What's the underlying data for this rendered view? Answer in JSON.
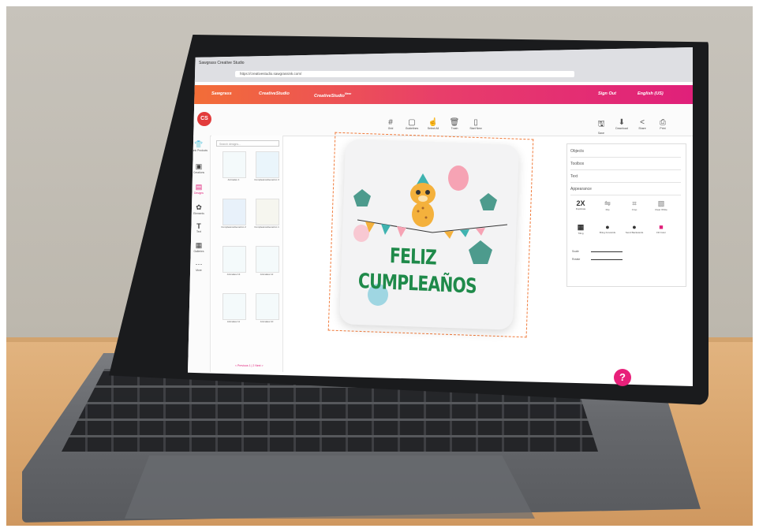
{
  "browser": {
    "tab_title": "Sawgrass Creative Studio",
    "url": "https://creativestudio.sawgrassink.com/"
  },
  "nav": {
    "brand": "Sawgrass",
    "creative_studio": "CreativeStudio",
    "creative_studio_new": "CreativeStudio",
    "new_badge": "New",
    "sign_out": "Sign Out",
    "language": "English (US)"
  },
  "logo": "CS",
  "toolbar": {
    "grid": "Grid",
    "guidelines": "Guidelines",
    "select_all": "Select All",
    "trash": "Trash",
    "start_new": "Start New",
    "save": "Save",
    "download": "Download",
    "share": "Share",
    "print": "Print"
  },
  "leftnav": {
    "items": [
      {
        "label": "Blank Products",
        "icon": "tshirt-icon",
        "glyph": "👕"
      },
      {
        "label": "Creations",
        "icon": "creations-icon",
        "glyph": "▣"
      },
      {
        "label": "Designs",
        "icon": "designs-icon",
        "glyph": "▤"
      },
      {
        "label": "Elements",
        "icon": "elements-icon",
        "glyph": "✿"
      },
      {
        "label": "Text",
        "icon": "text-icon",
        "glyph": "T"
      },
      {
        "label": "Galleries",
        "icon": "galleries-icon",
        "glyph": "▦"
      },
      {
        "label": "More",
        "icon": "more-icon",
        "glyph": "⋯"
      }
    ]
  },
  "designs_panel": {
    "search_placeholder": "Search designs...",
    "thumbs": [
      "Animales 1",
      "CumpleanosGenerico 3",
      "CumpleanosGenerico 2",
      "CumpleanosGenerico 1",
      "Animales 13",
      "Animales 12",
      "Animales 11",
      "Animales 10"
    ],
    "pager": "< Previous 1 | 2 Next >"
  },
  "canvas": {
    "line1": "FELIZ",
    "line2": "CUMPLEAÑOS"
  },
  "right_panel": {
    "objects": "Objects",
    "toolbox": "Toolbox",
    "text": "Text",
    "appearance": "Appearance",
    "tools": [
      {
        "label": "Duplicate",
        "glyph": "2X"
      },
      {
        "label": "Flip",
        "glyph": "⇋"
      },
      {
        "label": "Crop",
        "glyph": "⌗"
      },
      {
        "label": "Clear White",
        "glyph": "▧"
      },
      {
        "label": "Tiling",
        "glyph": "▦"
      },
      {
        "label": "Bring Forwards",
        "glyph": "●"
      },
      {
        "label": "Send Backwards",
        "glyph": "●"
      },
      {
        "label": "Fill Color",
        "glyph": "■"
      }
    ],
    "scale": "Scale",
    "rotate": "Rotate"
  },
  "help": "?",
  "colors": {
    "nav_start": "#f36f36",
    "nav_end": "#e0207a",
    "text_green": "#1f8a4a",
    "help_pink": "#e8207a"
  }
}
